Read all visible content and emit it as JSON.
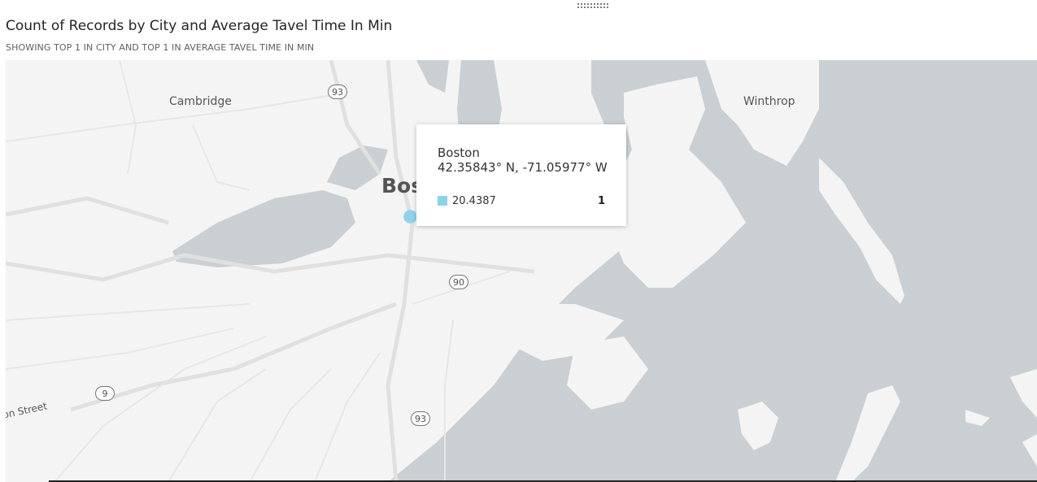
{
  "visual": {
    "title": "Count of Records by City and Average Tavel Time In Min",
    "subtitle": "SHOWING TOP 1 IN CITY AND TOP 1 IN AVERAGE TAVEL TIME IN MIN"
  },
  "map": {
    "labels": {
      "cambridge": "Cambridge",
      "winthrop": "Winthrop",
      "boston_partial": "Bos",
      "street_partial": "on Street"
    },
    "route_shields": [
      "93",
      "90",
      "9",
      "93"
    ],
    "colors": {
      "water": "#c9cfd2",
      "land": "#f4f4f4",
      "roads": "#e2e2e2",
      "bubble": "#8fd3ea"
    }
  },
  "tooltip": {
    "city": "Boston",
    "coordinates": "42.35843° N, -71.05977° W",
    "series_label": "20.4387",
    "value": "1"
  },
  "chart_data": {
    "type": "map",
    "points": [
      {
        "city": "Boston",
        "latitude": 42.35843,
        "longitude": -71.05977,
        "average_tavel_time_in_min": 20.4387,
        "count_of_records": 1
      }
    ]
  }
}
